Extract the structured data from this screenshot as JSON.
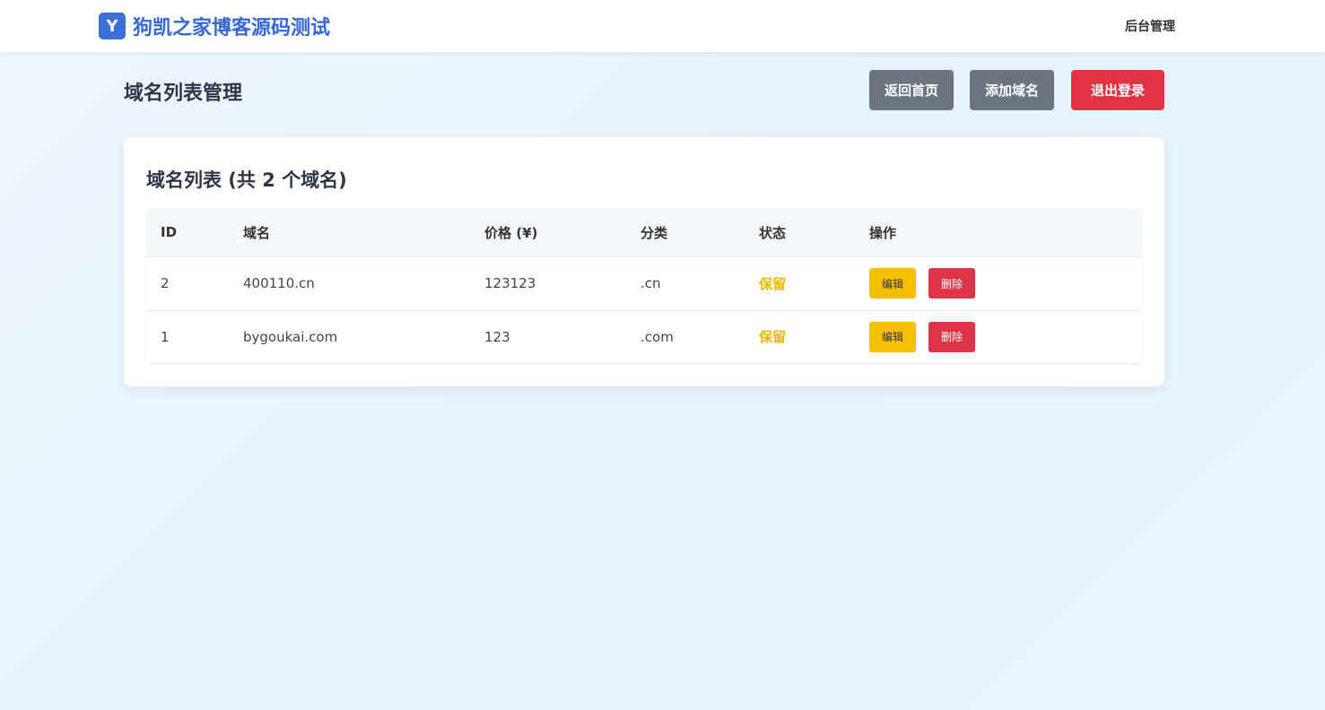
{
  "header": {
    "logo_letter": "Y",
    "site_name": "狗凯之家博客源码测试",
    "admin_link": "后台管理"
  },
  "page": {
    "title": "域名列表管理",
    "buttons": {
      "home": "返回首页",
      "add": "添加域名",
      "logout": "退出登录"
    }
  },
  "card": {
    "title": "域名列表 (共 2 个域名)"
  },
  "table": {
    "columns": [
      "ID",
      "域名",
      "价格 (¥)",
      "分类",
      "状态",
      "操作"
    ],
    "rows": [
      {
        "id": "2",
        "domain": "400110.cn",
        "price": "123123",
        "category": ".cn",
        "status": "保留",
        "edit": "编辑",
        "delete": "删除"
      },
      {
        "id": "1",
        "domain": "bygoukai.com",
        "price": "123",
        "category": ".com",
        "status": "保留",
        "edit": "编辑",
        "delete": "删除"
      }
    ]
  },
  "colors": {
    "brand": "#3567d6",
    "logout": "#e03444",
    "secondary": "#6c757d",
    "edit": "#f6c000",
    "delete": "#dc3545",
    "status_reserved": "#f0b400"
  }
}
